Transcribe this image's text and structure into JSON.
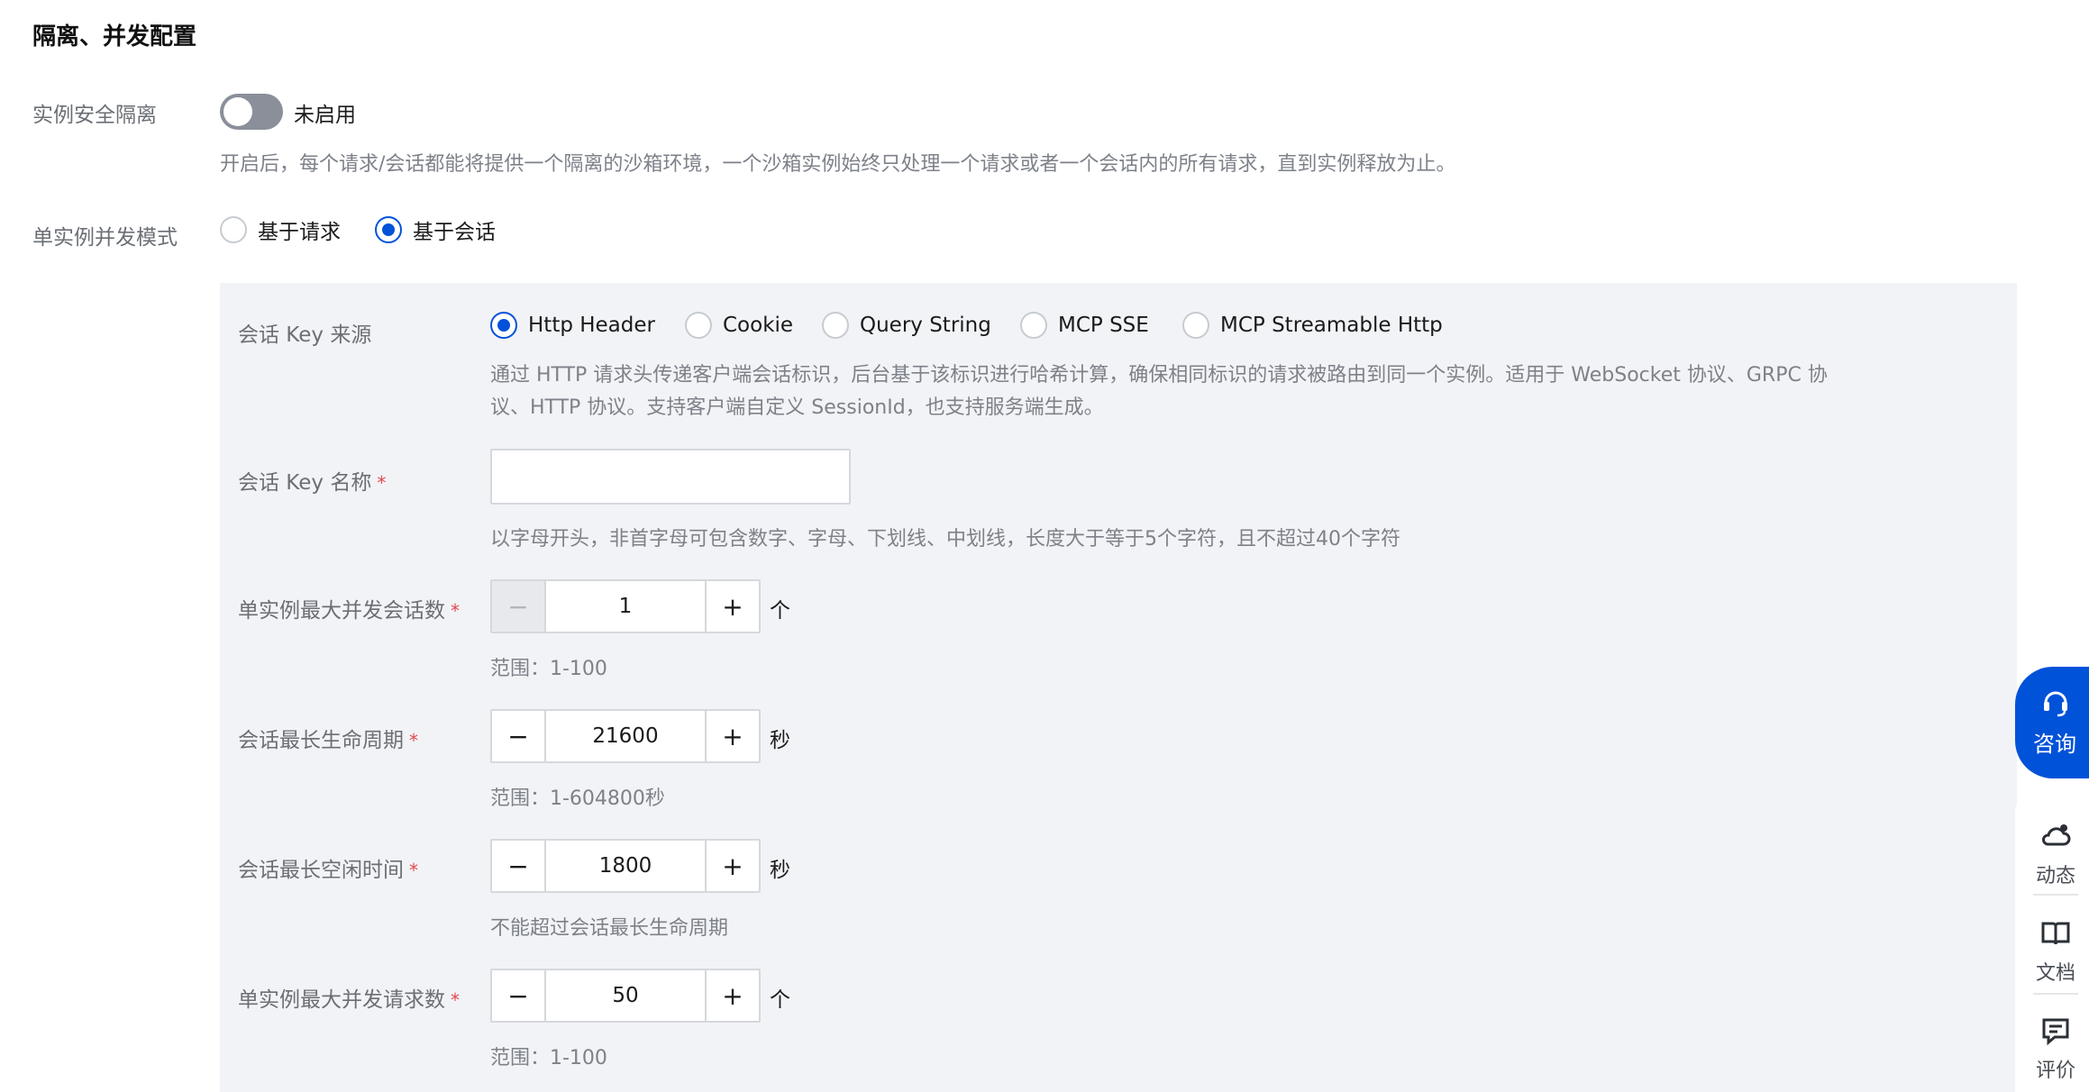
{
  "section": {
    "title": "隔离、并发配置"
  },
  "isolation": {
    "label": "实例安全隔离",
    "toggle_state": "未启用",
    "enabled": false,
    "help": "开启后，每个请求/会话都能将提供一个隔离的沙箱环境，一个沙箱实例始终只处理一个请求或者一个会话内的所有请求，直到实例释放为止。"
  },
  "concurrency_mode": {
    "label": "单实例并发模式",
    "options": [
      {
        "label": "基于请求",
        "checked": false
      },
      {
        "label": "基于会话",
        "checked": true
      }
    ]
  },
  "session_key_source": {
    "label": "会话 Key 来源",
    "options": [
      {
        "label": "Http Header",
        "checked": true
      },
      {
        "label": "Cookie",
        "checked": false
      },
      {
        "label": "Query String",
        "checked": false
      },
      {
        "label": "MCP SSE",
        "checked": false
      },
      {
        "label": "MCP Streamable Http",
        "checked": false
      }
    ],
    "help_line1": "通过 HTTP 请求头传递客户端会话标识，后台基于该标识进行哈希计算，确保相同标识的请求被路由到同一个实例。适用于 WebSocket 协议、GRPC 协",
    "help_line2": "议、HTTP 协议。支持客户端自定义 SessionId，也支持服务端生成。"
  },
  "session_key_name": {
    "label": "会话 Key 名称",
    "required_mark": "*",
    "value": "",
    "help": "以字母开头，非首字母可包含数字、字母、下划线、中划线，长度大于等于5个字符，且不超过40个字符"
  },
  "max_sessions": {
    "label": "单实例最大并发会话数",
    "required_mark": "*",
    "value": "1",
    "unit": "个",
    "help": "范围：1-100"
  },
  "session_lifetime": {
    "label": "会话最长生命周期",
    "required_mark": "*",
    "value": "21600",
    "unit": "秒",
    "help": "范围：1-604800秒"
  },
  "session_idle": {
    "label": "会话最长空闲时间",
    "required_mark": "*",
    "value": "1800",
    "unit": "秒",
    "help": "不能超过会话最长生命周期"
  },
  "max_requests": {
    "label": "单实例最大并发请求数",
    "required_mark": "*",
    "value": "50",
    "unit": "个",
    "help": "范围：1-100"
  },
  "stepper": {
    "minus": "−",
    "plus": "+"
  },
  "side": {
    "consult": "咨询",
    "tools": [
      {
        "label": "动态",
        "icon": "cloud-bell-icon"
      },
      {
        "label": "文档",
        "icon": "book-icon"
      },
      {
        "label": "评价",
        "icon": "comment-icon"
      }
    ]
  },
  "colors": {
    "primary": "#0052d9",
    "required": "#e5484d",
    "panel_bg": "#f2f3f6"
  }
}
